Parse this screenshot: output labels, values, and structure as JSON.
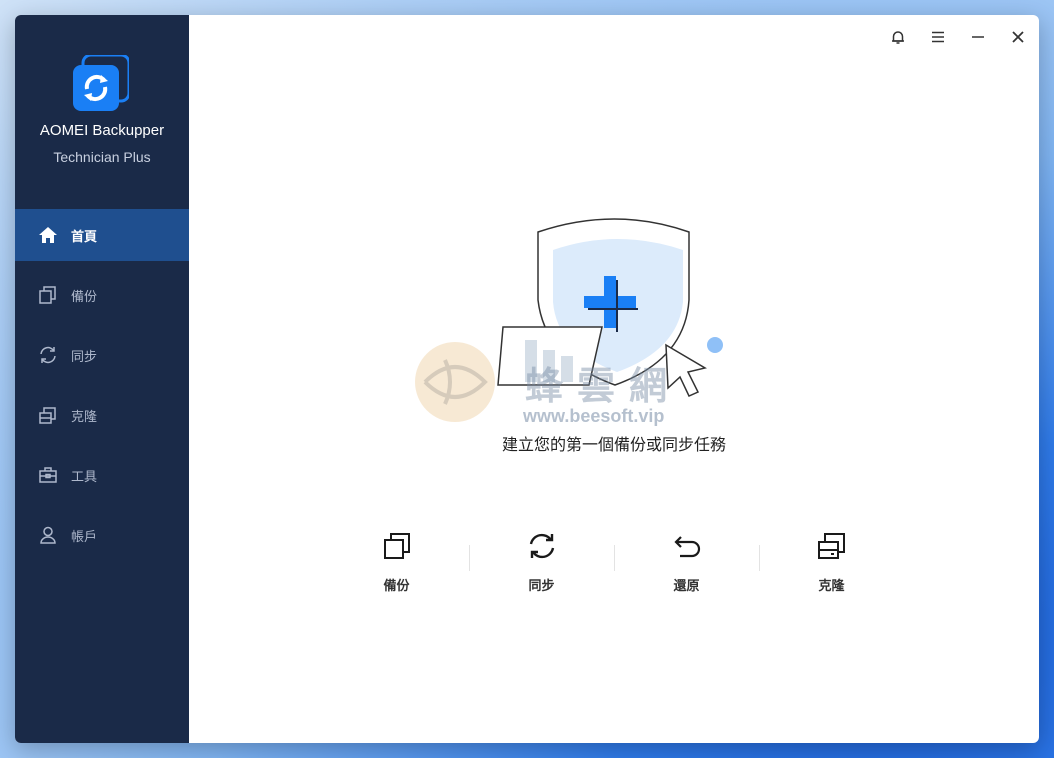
{
  "app": {
    "name": "AOMEI Backupper",
    "edition": "Technician Plus"
  },
  "sidebar": {
    "items": [
      {
        "label": "首頁",
        "icon": "home-icon",
        "active": true
      },
      {
        "label": "備份",
        "icon": "backup-icon",
        "active": false
      },
      {
        "label": "同步",
        "icon": "sync-icon",
        "active": false
      },
      {
        "label": "克隆",
        "icon": "clone-icon",
        "active": false
      },
      {
        "label": "工具",
        "icon": "toolbox-icon",
        "active": false
      },
      {
        "label": "帳戶",
        "icon": "user-icon",
        "active": false
      }
    ]
  },
  "titlebar": {
    "buttons": [
      "bell-icon",
      "menu-icon",
      "minimize-icon",
      "close-icon"
    ]
  },
  "main": {
    "headline": "建立您的第一個備份或同步任務",
    "watermark": {
      "text": "蜂雲網",
      "url": "www.beesoft.vip"
    },
    "actions": [
      {
        "label": "備份",
        "icon": "backup-icon"
      },
      {
        "label": "同步",
        "icon": "sync-icon"
      },
      {
        "label": "還原",
        "icon": "restore-icon"
      },
      {
        "label": "克隆",
        "icon": "clone-icon"
      }
    ]
  },
  "colors": {
    "sidebar_bg": "#1a2a48",
    "sidebar_active": "#1f4f8f",
    "accent": "#1a7ff5",
    "window_bg": "#ffffff"
  }
}
